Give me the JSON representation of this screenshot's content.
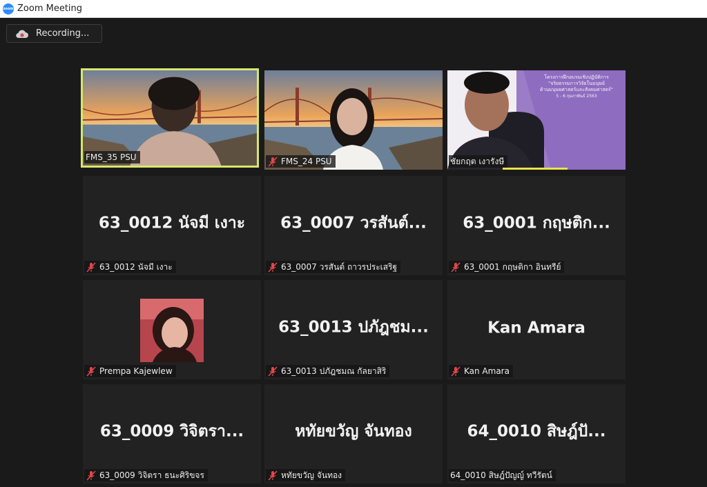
{
  "window": {
    "title": "Zoom Meeting",
    "logo_text": "zoom"
  },
  "recording": {
    "label": "Recording..."
  },
  "slide": {
    "line1": "โครงการฝึกอบรมเชิงปฏิบัติการ",
    "line2": "\"จริยธรรมการวิจัยในมนุษย์",
    "line3": "ด้านมนุษยศาสตร์และสังคมศาสตร์\"",
    "line4": "5 - 6 กุมภาพันธ์ 2563"
  },
  "participants": [
    {
      "label": "FMS_35 PSU",
      "display_name": "",
      "muted": false
    },
    {
      "label": "FMS_24 PSU",
      "display_name": "",
      "muted": true
    },
    {
      "label": "ชัยกฤต  เงารังษี",
      "display_name": "",
      "muted": false
    },
    {
      "label": "63_0012 นัจมี เงาะ",
      "display_name": "63_0012 นัจมี เงาะ",
      "muted": true
    },
    {
      "label": "63_0007 วรสันต์ ถาวรประเสริฐ",
      "display_name": "63_0007 วรสันต์...",
      "muted": true
    },
    {
      "label": "63_0001 กฤษติกา อินทรีย์",
      "display_name": "63_0001 กฤษติก...",
      "muted": true
    },
    {
      "label": "Prempa Kajewlew",
      "display_name": "",
      "muted": true
    },
    {
      "label": "63_0013 ปภัฎชมณ กัลยาสิริ",
      "display_name": "63_0013 ปภัฎชม...",
      "muted": true
    },
    {
      "label": "Kan Amara",
      "display_name": "Kan Amara",
      "muted": true
    },
    {
      "label": "63_0009 วิจิตรา ธนะศิริขจร",
      "display_name": "63_0009 วิจิตรา...",
      "muted": true
    },
    {
      "label": "หทัยขวัญ จันทอง",
      "display_name": "หทัยขวัญ  จันทอง",
      "muted": true
    },
    {
      "label": "64_0010 สิษฎ์ปัญญ์ ทวีรัตน์",
      "display_name": "64_0010 สิษฎ์ปั...",
      "muted": false
    }
  ],
  "colors": {
    "active_speaker_border": "#d6e86a",
    "mute_icon": "#e0474c",
    "tile_bg": "#222222"
  }
}
